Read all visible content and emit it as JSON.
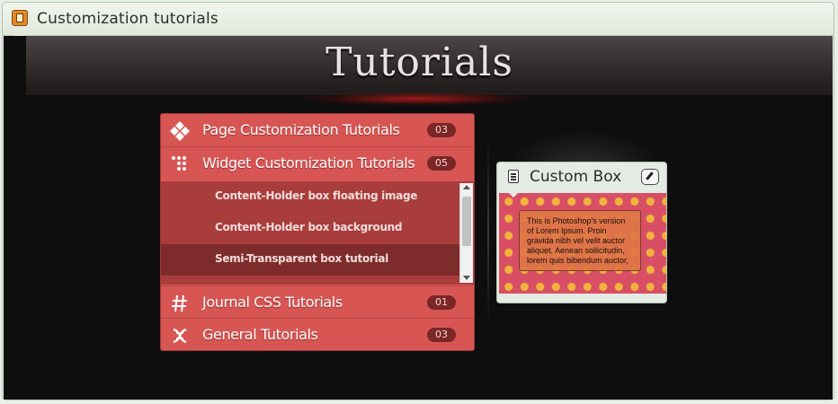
{
  "window": {
    "title": "Customization tutorials",
    "icon": "app-scroll-icon"
  },
  "header": {
    "title": "Tutorials"
  },
  "menu": {
    "items": [
      {
        "label": "Page Customization Tutorials",
        "count": "03",
        "icon": "diamond-grid-icon"
      },
      {
        "label": "Widget Customization Tutorials",
        "count": "05",
        "icon": "dots-grid-icon"
      },
      {
        "label": "Journal CSS Tutorials",
        "count": "01",
        "icon": "hash-icon"
      },
      {
        "label": "General Tutorials",
        "count": "03",
        "icon": "dna-icon"
      }
    ],
    "submenu": [
      {
        "label": "Content-Holder box floating image"
      },
      {
        "label": "Content-Holder box background"
      },
      {
        "label": "Semi-Transparent box tutorial"
      }
    ]
  },
  "custom_box": {
    "title": "Custom Box",
    "body": "This is Photoshop's version of Lorem Ipsum. Proin gravida nibh vel velit auctor aliquet. Aenean sollicitudin, lorem quis bibendum auctor,"
  },
  "colors": {
    "menu": "#d75654",
    "submenu": "#a83d3b",
    "submenu_active": "#7e2c2b",
    "badge": "#7b2626",
    "pattern_bg": "#d84f65",
    "pattern_dot": "#f0b43c"
  }
}
